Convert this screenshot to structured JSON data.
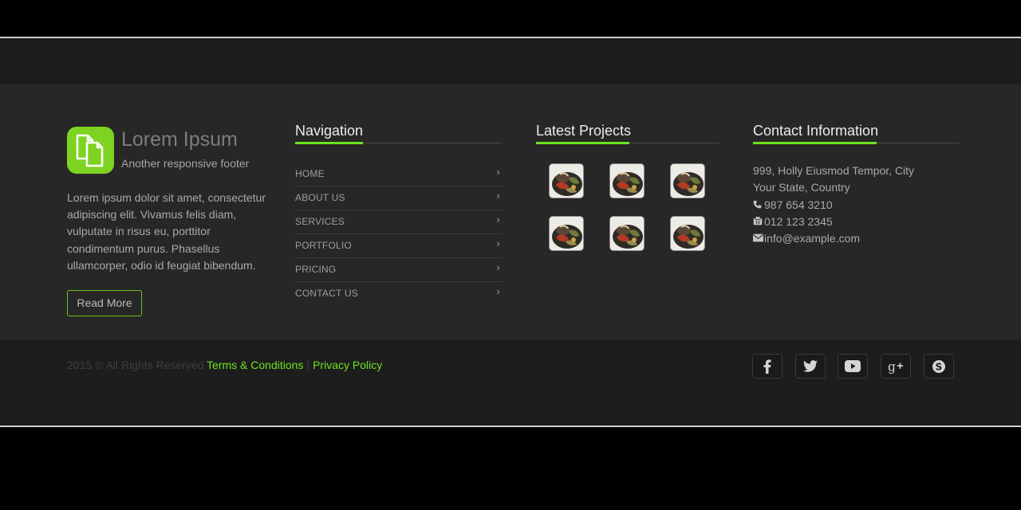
{
  "brand": {
    "title": "Lorem Ipsum",
    "subtitle": "Another responsive footer",
    "icon": "files-icon",
    "accent_color": "#7ed321"
  },
  "about": {
    "text": "Lorem ipsum dolor sit amet, consectetur adipiscing elit. Vivamus felis diam, vulputate in risus eu, porttitor condimentum purus. Phasellus ullamcorper, odio id feugiat bibendum.",
    "button_label": "Read More"
  },
  "navigation": {
    "heading": "Navigation",
    "items": [
      {
        "label": "HOME"
      },
      {
        "label": "ABOUT US"
      },
      {
        "label": "SERVICES"
      },
      {
        "label": "PORTFOLIO"
      },
      {
        "label": "PRICING"
      },
      {
        "label": "CONTACT US"
      }
    ],
    "chevron": "›"
  },
  "projects": {
    "heading": "Latest Projects",
    "thumbnail_count": 6
  },
  "contact": {
    "heading": "Contact Information",
    "address_line1": "999, Holly Eiusmod Tempor, City",
    "address_line2": "Your State, Country",
    "phone": "987 654 3210",
    "fax": "012 123 2345",
    "email": "info@example.com"
  },
  "bottom": {
    "copyright": "2015 © All Rights Reserved",
    "terms_label": "Terms & Conditions",
    "separator": "|",
    "privacy_label": "Privacy Policy",
    "social": [
      {
        "icon": "facebook-icon"
      },
      {
        "icon": "twitter-icon"
      },
      {
        "icon": "youtube-icon"
      },
      {
        "icon": "google-plus-icon"
      },
      {
        "icon": "skype-icon"
      }
    ]
  }
}
